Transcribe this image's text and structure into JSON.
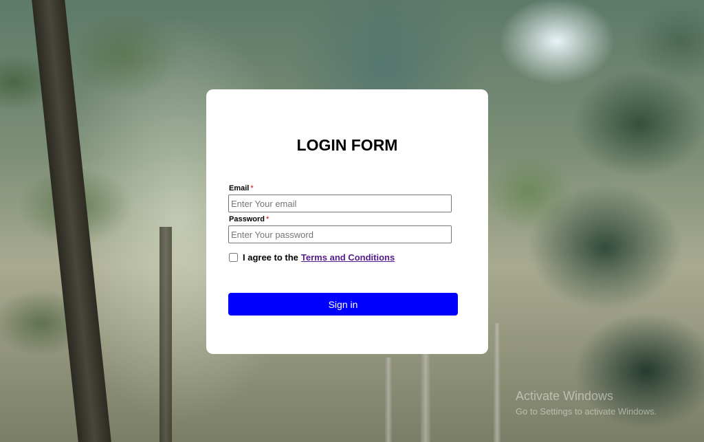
{
  "form": {
    "title": "LOGIN FORM",
    "email": {
      "label": "Email",
      "required_mark": "*",
      "placeholder": "Enter Your email",
      "value": ""
    },
    "password": {
      "label": "Password",
      "required_mark": "*",
      "placeholder": "Enter Your password",
      "value": ""
    },
    "agree": {
      "text": "I agree to the",
      "link_text": "Terms and Conditions",
      "checked": false
    },
    "submit_label": "Sign in"
  },
  "watermark": {
    "line1": "Activate Windows",
    "line2": "Go to Settings to activate Windows."
  },
  "colors": {
    "submit_bg": "#0000ff",
    "link": "#551a8b",
    "required": "#d00000"
  },
  "background": "forest-sunlight-image"
}
